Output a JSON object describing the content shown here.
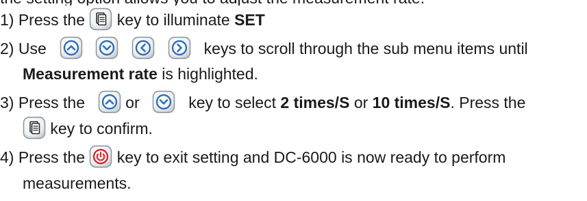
{
  "cut_off_line": "the setting option allows you to adjust the measurement rate.",
  "steps": [
    {
      "number": "1)",
      "press_the": "Press the",
      "after_key": "key to illuminate",
      "highlight": "SET"
    },
    {
      "number": "2)",
      "use": "Use",
      "after_keys": "keys to scroll through the sub menu items until",
      "highlight": "Measurement rate",
      "tail": "is highlighted."
    },
    {
      "number": "3)",
      "press_the": "Press the",
      "or": "or",
      "key_to_select": "key to select",
      "option_1": "2 times/S",
      "or2": "or",
      "option_2": "10 times/S",
      "period": ".",
      "press_the_2": "Press the",
      "confirm": "key to confirm."
    },
    {
      "number": "4)",
      "press_the": "Press the",
      "after_key": "key to exit setting and DC-6000 is now ready to perform",
      "tail": "measurements."
    }
  ],
  "icons": {
    "menu_key": "menu-key-icon",
    "up_key": "up-arrow-key-icon",
    "down_key": "down-arrow-key-icon",
    "left_key": "left-arrow-key-icon",
    "right_key": "right-arrow-key-icon",
    "power_key": "power-key-icon"
  },
  "colors": {
    "key_blue": "#2f6fb5",
    "key_red": "#d62a2a",
    "key_face": "#f4f6f8"
  }
}
